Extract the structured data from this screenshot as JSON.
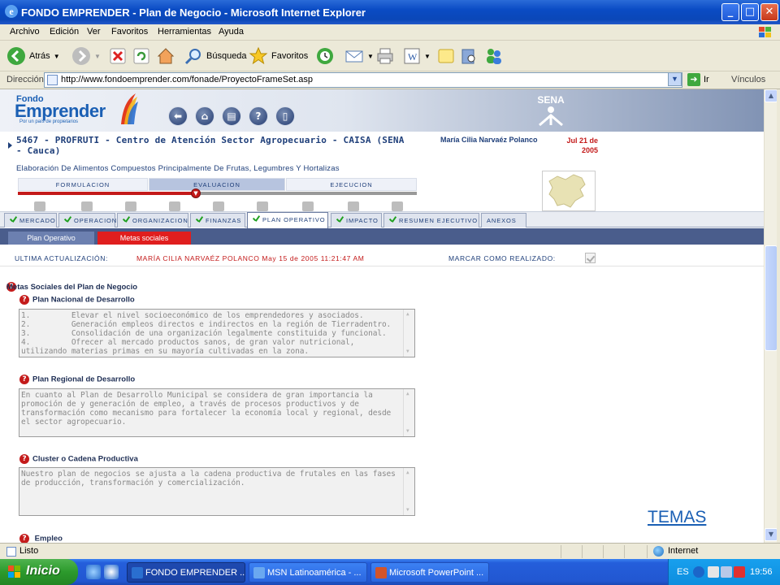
{
  "window": {
    "title": "FONDO EMPRENDER - Plan de Negocio - Microsoft Internet Explorer",
    "minimize": "_",
    "maximize": "□",
    "close": "✕"
  },
  "menu": [
    "Archivo",
    "Edición",
    "Ver",
    "Favoritos",
    "Herramientas",
    "Ayuda"
  ],
  "toolbar": {
    "back_label": "Atrás",
    "search_label": "Búsqueda",
    "favorites_label": "Favoritos"
  },
  "address": {
    "label": "Dirección",
    "url": "http://www.fondoemprender.com/fonade/ProyectoFrameSet.asp",
    "go_label": "Ir",
    "links_label": "Vínculos"
  },
  "site": {
    "logo_top": "Fondo",
    "logo_main": "Emprender",
    "logo_tagline": "Por un país de propietarios",
    "sena": "SENA",
    "nav_icons": [
      "back-circle-icon",
      "home-circle-icon",
      "print-circle-icon",
      "help-circle-icon",
      "exit-circle-icon"
    ]
  },
  "project": {
    "title": "5467 - PROFRUTI - Centro de Atención Sector Agropecuario - CAISA (SENA - Cauca)",
    "user": "María Cilia Narvaéz Polanco",
    "date": "Jul 21 de 2005",
    "subtitle": "Elaboración De Alimentos Compuestos Principalmente De Frutas, Legumbres Y Hortalizas"
  },
  "phases": {
    "items": [
      "FORMULACION",
      "EVALUACION",
      "EJECUCION"
    ],
    "active": "EVALUACION",
    "progress": 0.45
  },
  "tabs": [
    {
      "label": "MERCADO",
      "checked": true
    },
    {
      "label": "OPERACION",
      "checked": true
    },
    {
      "label": "ORGANIZACION",
      "checked": true
    },
    {
      "label": "FINANZAS",
      "checked": true
    },
    {
      "label": "PLAN OPERATIVO",
      "checked": true,
      "active": true
    },
    {
      "label": "IMPACTO",
      "checked": true
    },
    {
      "label": "RESUMEN EJECUTIVO",
      "checked": true
    },
    {
      "label": "ANEXOS",
      "checked": false
    }
  ],
  "subtabs": {
    "plan_operativo": "Plan Operativo",
    "metas_sociales": "Metas sociales"
  },
  "update": {
    "label": "ULTIMA ACTUALIZACIÓN:",
    "value": "MARÍA CILIA NARVAÉZ POLANCO  May 15 de 2005 11:21:47 AM",
    "mark_label": "MARCAR COMO REALIZADO:",
    "mark_checked": true
  },
  "content": {
    "heading": "Metas Sociales del Plan de Negocio",
    "sections": [
      {
        "title": "Plan Nacional de Desarrollo",
        "text": "1.         Elevar el nivel socioeconómico de los emprendedores y asociados.\n2.         Generación empleos directos e indirectos en la región de Tierradentro.\n3.         Consolidación de una organización legalmente constituida y funcional.\n4.         Ofrecer al mercado productos sanos, de gran valor nutricional, utilizando materias primas en su mayoría cultivadas en la zona."
      },
      {
        "title": "Plan Regional de Desarrollo",
        "text": "En cuanto al Plan de Desarrollo Municipal se considera de gran importancia la promoción de y generación de empleo, a través de procesos productivos y de transformación como mecanismo para fortalecer la economía local y regional, desde el sector agropecuario."
      },
      {
        "title": "Cluster o Cadena Productiva",
        "text": "Nuestro plan de negocios se ajusta a la cadena productiva de frutales en las fases de producción, transformación y comercialización."
      },
      {
        "title": "Empleo",
        "text": ""
      }
    ],
    "temas_link": "TEMAS"
  },
  "status": {
    "text": "Listo",
    "zone": "Internet"
  },
  "taskbar": {
    "start": "Inicio",
    "tasks": [
      {
        "label": "FONDO EMPRENDER ...",
        "active": true
      },
      {
        "label": "MSN Latinoamérica - ...",
        "active": false
      },
      {
        "label": "Microsoft PowerPoint ...",
        "active": false
      }
    ],
    "lang": "ES",
    "clock": "19:56"
  },
  "colors": {
    "accent_red": "#c31919",
    "navy": "#1f3f7a",
    "xp_blue": "#245edb",
    "start_green": "#2c9a2c"
  }
}
